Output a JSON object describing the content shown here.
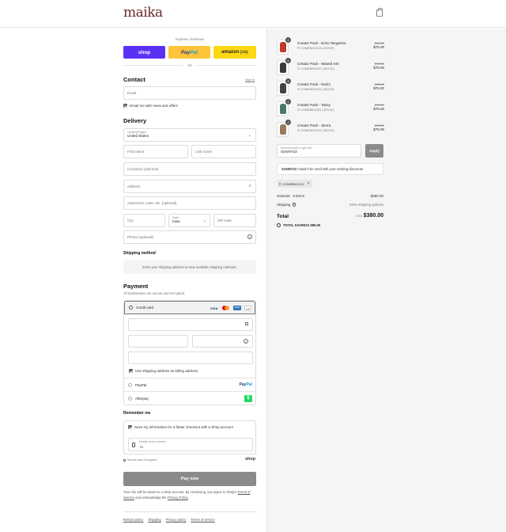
{
  "header": {
    "logo": "maika"
  },
  "express": {
    "title": "Express checkout",
    "shop": "shop",
    "paypal_pay": "Pay",
    "paypal_pal": "Pal",
    "amazon": "amazon",
    "amazon_pay": "pay",
    "or": "OR"
  },
  "contact": {
    "title": "Contact",
    "sign_in": "Sign in",
    "email_placeholder": "Email",
    "news_label": "Email me with news and offers"
  },
  "delivery": {
    "title": "Delivery",
    "country_label": "Country/Region",
    "country_value": "United States",
    "first_name": "First name",
    "last_name": "Last name",
    "company": "Company (optional)",
    "address": "Address",
    "apartment": "Apartment, suite, etc. (optional)",
    "city": "City",
    "state_label": "State",
    "state_value": "Iowa",
    "zip": "ZIP code",
    "phone": "Phone (optional)"
  },
  "shipping": {
    "title": "Shipping method",
    "message": "Enter your shipping address to view available shipping methods."
  },
  "payment": {
    "title": "Payment",
    "subtitle": "All transactions are secure and encrypted.",
    "credit_card": "Credit card",
    "visa": "VISA",
    "amex": "AMEX",
    "more": "+1",
    "billing_label": "Use shipping address as billing address",
    "paypal": "PayPal",
    "paypal_logo_a": "Pay",
    "paypal_logo_b": "Pal",
    "afterpay": "Afterpay",
    "afterpay_symbol": "$"
  },
  "remember": {
    "title": "Remember me",
    "save_label": "Save my information for a faster checkout with a Shop account",
    "mobile_label": "Mobile phone number",
    "mobile_value": "+1",
    "secure": "Secure and encrypted",
    "shop": "shop"
  },
  "pay_button": "Pay now",
  "legal": {
    "text": "Your info will be saved to a Shop account. By continuing, you agree to Shop's",
    "terms": "Terms of Service",
    "and": "and acknowledge the",
    "privacy": "Privacy Policy",
    "period": "."
  },
  "footer": {
    "refund": "Refund policy",
    "shipping": "Shipping",
    "privacy": "Privacy policy",
    "terms": "Terms of service"
  },
  "cart": {
    "items": [
      {
        "name": "Creator Pack - Echo Tangerine",
        "discount": "COMEBACK20 (-$19.00)",
        "original": "$95.00",
        "price": "$76.00",
        "qty": "1",
        "color": "#c0392b"
      },
      {
        "name": "Creator Pack - Waxed Ash",
        "discount": "COMEBACK20 (-$19.00)",
        "original": "$95.00",
        "price": "$76.00",
        "qty": "1",
        "color": "#3a3a3a"
      },
      {
        "name": "Creator Pack - Nochi",
        "discount": "COMEBACK20 (-$19.00)",
        "original": "$95.00",
        "price": "$76.00",
        "qty": "1",
        "color": "#444444"
      },
      {
        "name": "Creator Pack - Tansy",
        "discount": "COMEBACK20 (-$19.00)",
        "original": "$95.00",
        "price": "$76.00",
        "qty": "1",
        "color": "#4a7a6a"
      },
      {
        "name": "Creator Pack - Sierra",
        "discount": "COMEBACK20 (-$19.00)",
        "original": "$95.00",
        "price": "$76.00",
        "qty": "1",
        "color": "#9a7a5a"
      }
    ],
    "discount_label": "Discount code or gift card",
    "discount_value": "SUNNY22",
    "apply": "Apply",
    "error_code": "SUNNY22",
    "error_text": "couldn't be used with your existing discounts.",
    "applied_code": "COMEBACK20",
    "subtotal_label": "Subtotal · 5 items",
    "subtotal_value": "$380.00",
    "shipping_label": "Shipping",
    "shipping_value": "Enter shipping address",
    "total_label": "Total",
    "currency": "USD",
    "total_value": "$380.00",
    "savings_label": "TOTAL SAVINGS",
    "savings_value": "$95.00"
  }
}
